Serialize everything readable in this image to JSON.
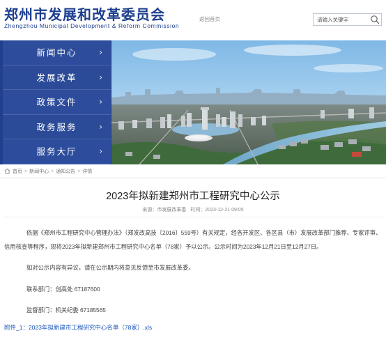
{
  "header": {
    "logo_cn": "郑州市发展和改革委员会",
    "logo_en": "Zhengzhou Municipal Development & Reform Commission",
    "home_link": "返回首页",
    "search_placeholder": "请输入关键字"
  },
  "nav": {
    "items": [
      {
        "label": "新闻中心"
      },
      {
        "label": "发展改革"
      },
      {
        "label": "政策文件"
      },
      {
        "label": "政务服务"
      },
      {
        "label": "服务大厅"
      }
    ],
    "chevron": "›"
  },
  "breadcrumb": [
    "首页",
    "新闻中心",
    "通知公告",
    "详情"
  ],
  "breadcrumb_sep": ">",
  "article": {
    "title": "2023年拟新建郑州市工程研究中心公示",
    "source_label": "来源：市发展改革委",
    "time_label": "时间：2023-12-21 09:05",
    "p1": "依据《郑州市工程研究中心管理办法》（郑发改高技〔2016〕559号）有关规定，经各开发区、各区县（市）发展改革部门推荐、专家评审、信用核查等程序，现将2023年拟新建郑州市工程研究中心名单（78家）予以公示。公示时间为2023年12月21日至12月27日。",
    "p2": "如对公示内容有异议，请在公示期内将意见反馈至市发展改革委。",
    "p3": "联系部门：创高处   67187600",
    "p4": "监督部门：机关纪委 67185565",
    "attachment": "附件_1：2023年拟新建市工程研究中心名单（78家）.xls"
  },
  "colors": {
    "brand_blue": "#1d3f8f",
    "nav_bg": "#2b4a97",
    "link_blue": "#1a55b8"
  }
}
